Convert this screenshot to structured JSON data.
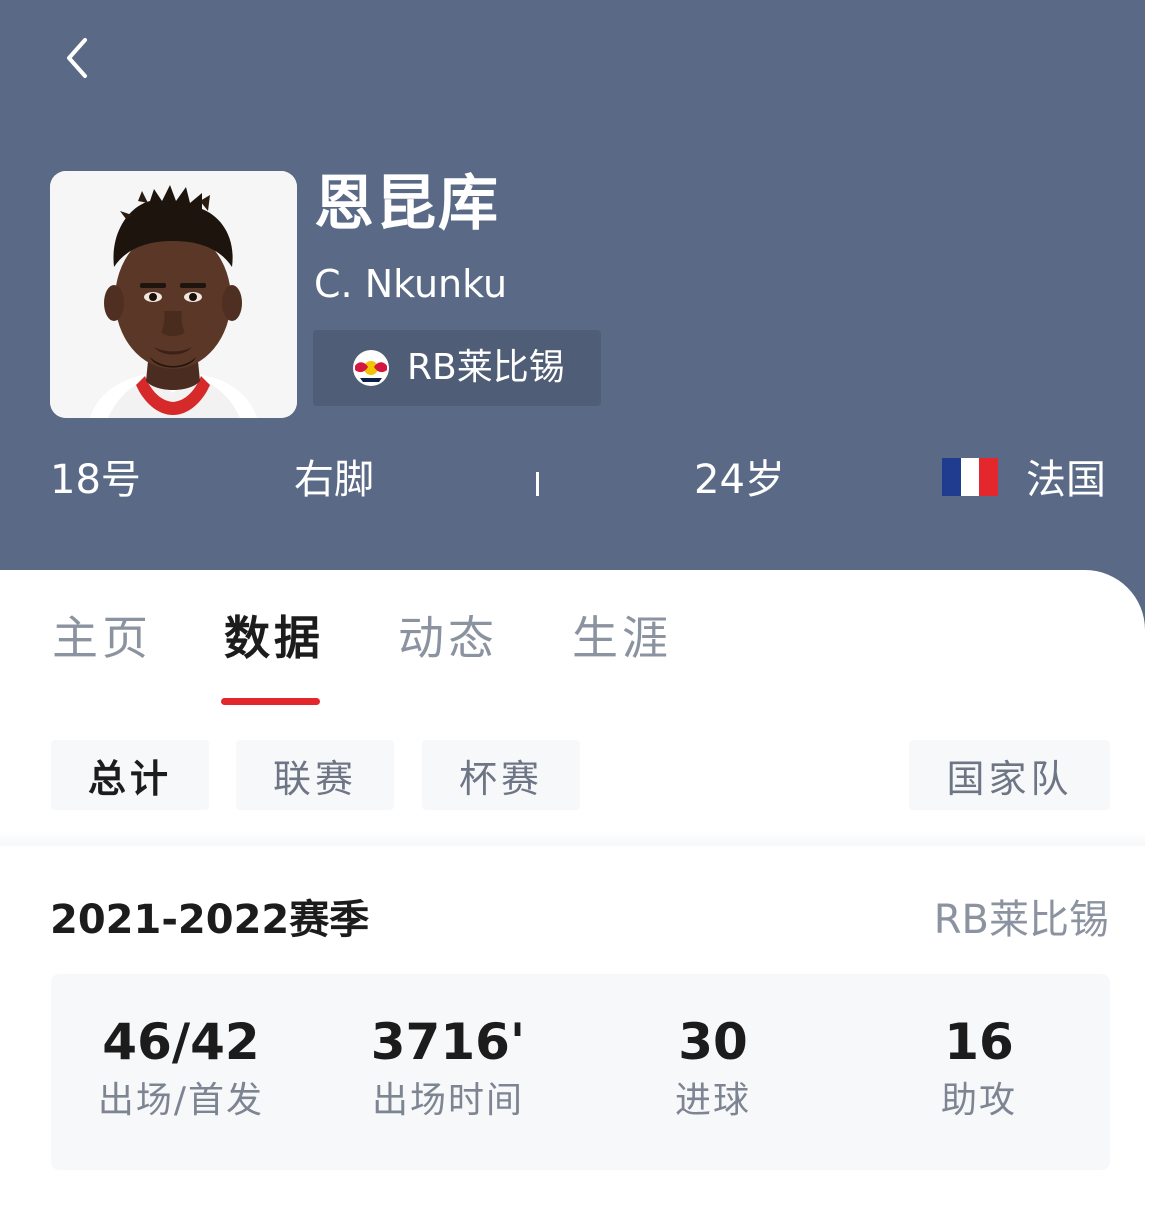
{
  "player": {
    "name_cn": "恩昆库",
    "name_en": "C. Nkunku",
    "team": "RB莱比锡",
    "number": "18号",
    "foot": "右脚",
    "age": "24岁",
    "nationality": "法国"
  },
  "tabs": [
    {
      "label": "主页"
    },
    {
      "label": "数据"
    },
    {
      "label": "动态"
    },
    {
      "label": "生涯"
    }
  ],
  "active_tab": "数据",
  "filters": [
    {
      "label": "总计"
    },
    {
      "label": "联赛"
    },
    {
      "label": "杯赛"
    },
    {
      "label": "国家队"
    }
  ],
  "active_filter": "总计",
  "season": {
    "label": "2021-2022赛季",
    "team": "RB莱比锡"
  },
  "stats": [
    {
      "value": "46/42",
      "label": "出场/首发"
    },
    {
      "value": "3716'",
      "label": "出场时间"
    },
    {
      "value": "30",
      "label": "进球"
    },
    {
      "value": "16",
      "label": "助攻"
    }
  ],
  "icons": {
    "back": "chevron-left-icon",
    "team_logo": "rb-leipzig-logo-icon",
    "flag": "france-flag-icon"
  },
  "colors": {
    "header_bg": "#5a6a86",
    "badge_bg": "#4f5d76",
    "accent": "#e4262d",
    "card_bg": "#f7f8fa",
    "flag_blue": "#1f3c8f",
    "flag_white": "#ffffff",
    "flag_red": "#e4262d"
  }
}
